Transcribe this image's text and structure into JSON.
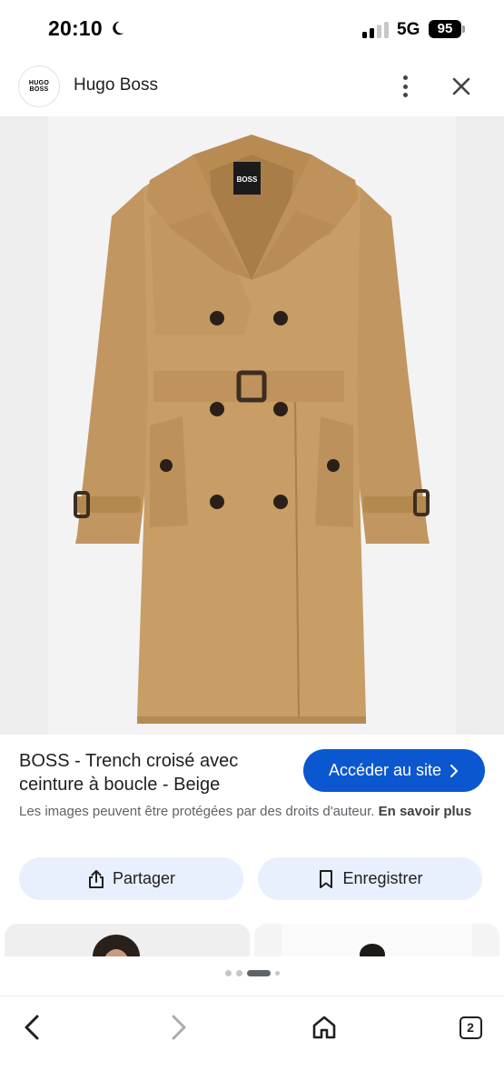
{
  "status_bar": {
    "time": "20:10",
    "network": "5G",
    "battery": "95"
  },
  "header": {
    "logo_line1": "HUGO",
    "logo_line2": "BOSS",
    "site_name": "Hugo Boss"
  },
  "product_image": {
    "brand_label": "BOSS"
  },
  "info": {
    "title": "BOSS - Trench croisé avec ceinture à boucle - Beige",
    "visit_label": "Accéder au site",
    "copyright_text": "Les images peuvent être protégées par des droits d'auteur.",
    "learn_more": "En savoir plus"
  },
  "actions": {
    "share_label": "Partager",
    "save_label": "Enregistrer"
  },
  "colors": {
    "accent": "#0b57d0",
    "tonal_button": "#e8f0fe",
    "coat": "#c49a62"
  },
  "bottom_nav": {
    "tab_count": "2"
  }
}
